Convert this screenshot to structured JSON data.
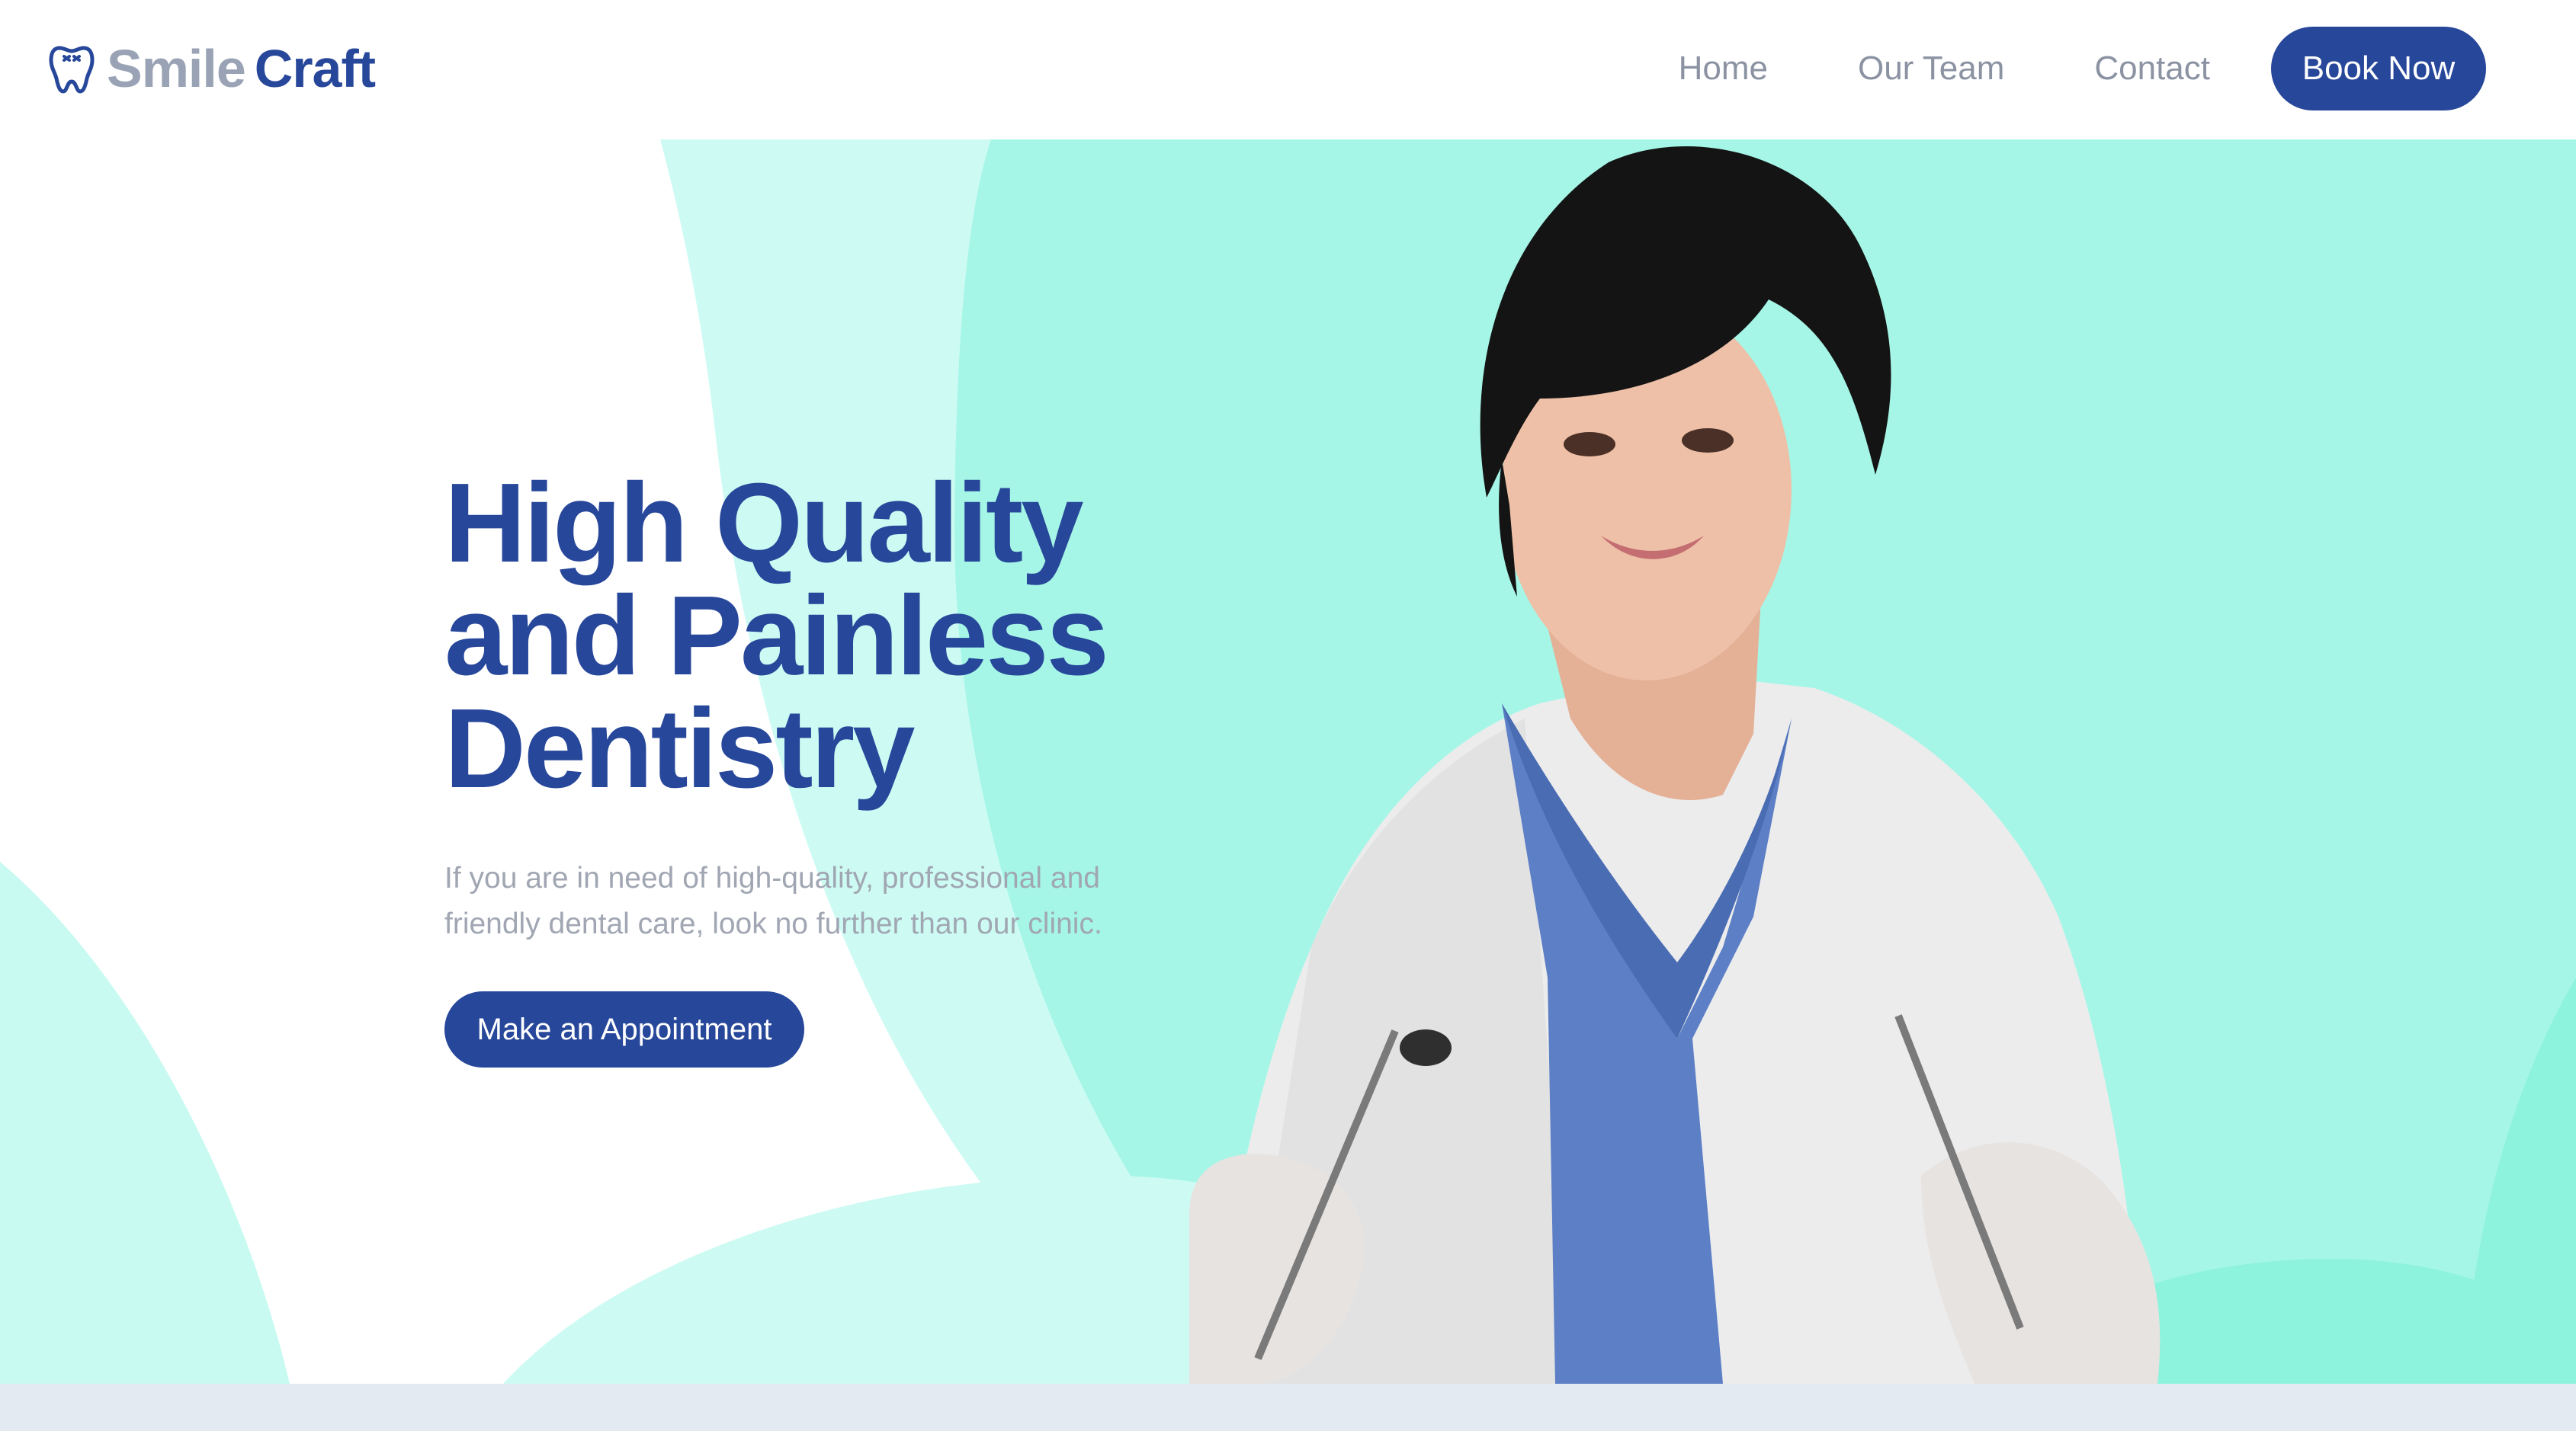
{
  "brand": {
    "name_part1": "Smile",
    "name_part2": "Craft",
    "icon": "tooth-icon",
    "color_primary": "#27479a",
    "color_muted": "#9aa3b5"
  },
  "nav": {
    "items": [
      {
        "label": "Home"
      },
      {
        "label": "Our Team"
      },
      {
        "label": "Contact"
      }
    ],
    "cta_label": "Book Now"
  },
  "hero": {
    "title_lines": [
      "High Quality",
      "and Painless",
      "Dentistry"
    ],
    "subtitle": "If you are in need of high-quality, professional and friendly dental care, look no further than our clinic.",
    "cta_label": "Make an Appointment",
    "image": "dentist-photo",
    "accent_color": "#a6f6e7"
  }
}
